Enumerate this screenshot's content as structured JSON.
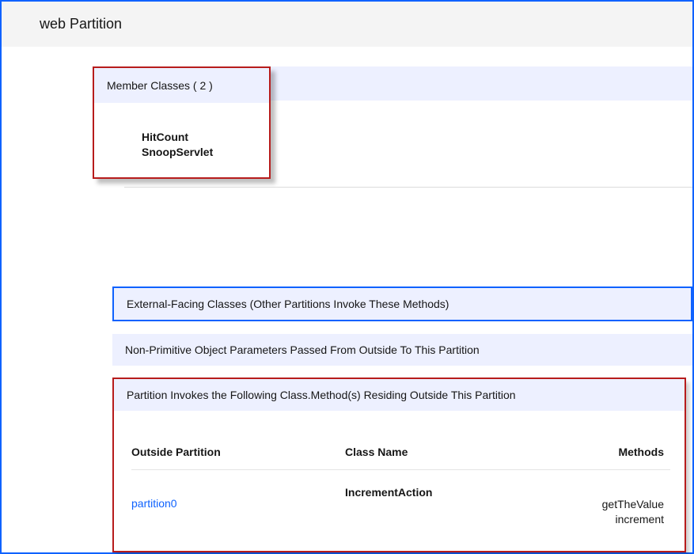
{
  "header": {
    "title": "web Partition"
  },
  "member_classes": {
    "header_label": "Member Classes ( 2 )",
    "items": [
      "HitCount",
      "SnoopServlet"
    ]
  },
  "external_facing": {
    "label": "External-Facing Classes (Other Partitions Invoke These Methods)"
  },
  "non_primitive": {
    "label": "Non-Primitive Object Parameters Passed From Outside To This Partition"
  },
  "invokes": {
    "label": "Partition Invokes the Following Class.Method(s) Residing Outside This Partition",
    "columns": {
      "partition": "Outside Partition",
      "class_name": "Class Name",
      "methods": "Methods"
    },
    "rows": [
      {
        "partition": "partition0",
        "class_name": "IncrementAction",
        "methods": [
          "getTheValue",
          "increment"
        ]
      }
    ]
  },
  "colors": {
    "accent_blue": "#0f62fe",
    "highlight_red": "#b71c1c",
    "section_bg": "#edf0ff"
  }
}
